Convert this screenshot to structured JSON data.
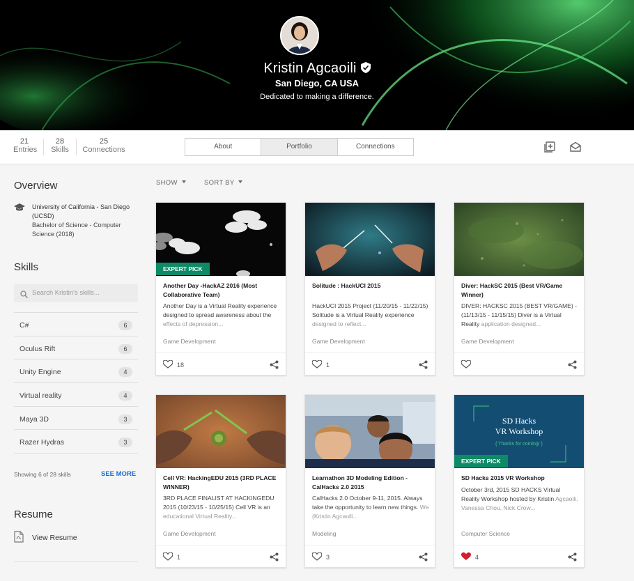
{
  "profile": {
    "name": "Kristin Agcaoili",
    "location": "San Diego, CA USA",
    "tagline": "Dedicated to making a difference."
  },
  "stats": [
    {
      "num": "21",
      "label": "Entries"
    },
    {
      "num": "28",
      "label": "Skills"
    },
    {
      "num": "25",
      "label": "Connections"
    }
  ],
  "tabs": [
    {
      "label": "About",
      "active": false
    },
    {
      "label": "Portfolio",
      "active": true
    },
    {
      "label": "Connections",
      "active": false
    }
  ],
  "sidebar": {
    "overview_title": "Overview",
    "school": "University of California - San Diego (UCSD)",
    "degree": "Bachelor of Science - Computer Science (2018)",
    "skills_title": "Skills",
    "search_placeholder": "Search Kristin's skills...",
    "skills": [
      {
        "label": "C#",
        "count": "6"
      },
      {
        "label": "Oculus Rift",
        "count": "6"
      },
      {
        "label": "Unity Engine",
        "count": "4"
      },
      {
        "label": "Virtual reality",
        "count": "4"
      },
      {
        "label": "Maya 3D",
        "count": "3"
      },
      {
        "label": "Razer Hydras",
        "count": "3"
      }
    ],
    "showing": "Showing 6 of 28 skills",
    "see_more": "SEE MORE",
    "resume_title": "Resume",
    "view_resume": "View Resume"
  },
  "filters": {
    "show": "SHOW",
    "sort": "SORT BY"
  },
  "cards": [
    {
      "title": "Another Day -HackAZ 2016 (Most Collaborative Team)",
      "desc": "Another Day is a Virtual Reality experience designed to spread awareness about the",
      "desc_fade": "effects of depression...",
      "category": "Game Development",
      "likes": "18",
      "expert_pick": "EXPERT PICK"
    },
    {
      "title": "Solitude : HackUCI 2015",
      "desc": "HackUCI 2015 Project (11/20/15 - 11/22/15) Solitude is a Virtual Reality experience",
      "desc_fade": "designed to reflect...",
      "category": "Game Development",
      "likes": "1"
    },
    {
      "title": "Diver: HackSC 2015 (Best VR/Game Winner)",
      "desc": "DIVER: HACKSC 2015 (BEST VR/GAME) - (11/13/15 - 11/15/15) Diver is a Virtual Reality",
      "desc_fade": "application designed...",
      "category": "Game Development",
      "likes": ""
    },
    {
      "title": "Cell VR: HackingEDU 2015 (3RD PLACE WINNER)",
      "desc": "3RD PLACE FINALIST AT HACKINGEDU 2015 (10/23/15 - 10/25/15) Cell VR is an",
      "desc_fade": "educational Virtual Reality...",
      "category": "Game Development",
      "likes": "1"
    },
    {
      "title": "Learnathon 3D Modeling Edition - CalHacks 2.0 2015",
      "desc": "CalHacks 2.0 October 9-11, 2015. Always take the opportunity to learn new things.",
      "desc_fade": "We (Kristin Agcaoili...",
      "category": "Modeling",
      "likes": "3"
    },
    {
      "title": "SD Hacks 2015 VR Workshop",
      "desc": "October 3rd, 2015 SD HACKS Virtual Reality Workshop hosted by Kristin",
      "desc_fade": "Agcaoili, Vanessa Chou, Nick Crow...",
      "category": "Computer Science",
      "likes": "4",
      "expert_pick": "EXPERT PICK",
      "thumb_title_1": "SD Hacks",
      "thumb_title_2": "VR Workshop",
      "thumb_sub": "{ Thanks for coming! }"
    }
  ],
  "colors": {
    "accent_green": "#0f8a66",
    "link_blue": "#1a6fd0",
    "liked_red": "#d0202e"
  }
}
